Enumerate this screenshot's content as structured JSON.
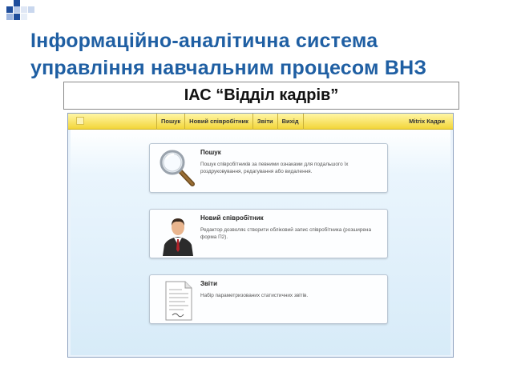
{
  "slide": {
    "title_line1": "Інформаційно-аналітична система",
    "title_line2": "управління навчальним процесом ВНЗ",
    "subtitle": "ІАС “Відділ кадрів”",
    "colors": {
      "title": "#1f5fa3",
      "bar": "#f3d63a",
      "background": "#ffffff"
    }
  },
  "app": {
    "menu": [
      {
        "label": "Пошук"
      },
      {
        "label": "Новий співробітник"
      },
      {
        "label": "Звіти"
      },
      {
        "label": "Вихід"
      }
    ],
    "brand": "Mitrix Кадри",
    "cards": [
      {
        "title": "Пошук",
        "description": "Пошук співробітників за певними ознаками для подальшого їх роздруковування, редагування або видалення.",
        "icon": "magnifier-icon"
      },
      {
        "title": "Новий співробітник",
        "description": "Редактор дозволяє створити обліковий запис співробітника (розширена форма П2).",
        "icon": "employee-icon"
      },
      {
        "title": "Звіти",
        "description": "Набір параметризованих статистичних звітів.",
        "icon": "report-document-icon"
      }
    ]
  }
}
